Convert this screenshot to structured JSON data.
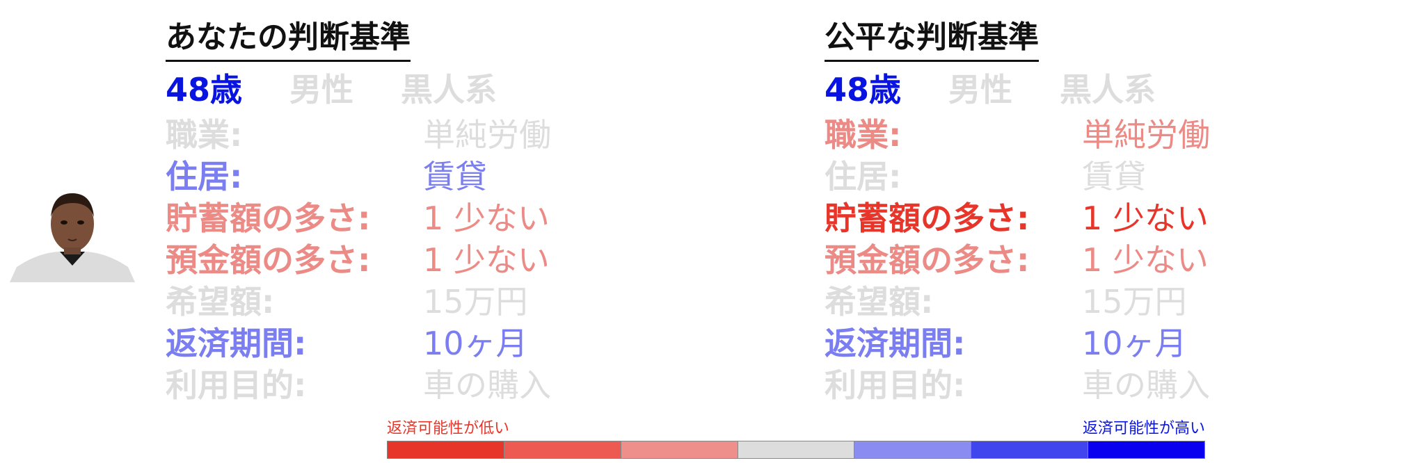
{
  "colors": {
    "gray": "#dddddd",
    "strong_blue": "#0a14e0",
    "mid_blue": "#7a7ef0",
    "strong_red": "#e8352a",
    "mid_red": "#ec8a86",
    "title": "#111111"
  },
  "left_panel": {
    "title": "あなたの判断基準",
    "age": "48歳",
    "gender": "男性",
    "ethnicity": "黒人系",
    "rows": [
      {
        "label": "職業:",
        "value": "単純労働"
      },
      {
        "label": "住居:",
        "value": "賃貸"
      },
      {
        "label": "貯蓄額の多さ:",
        "value": "1 少ない"
      },
      {
        "label": "預金額の多さ:",
        "value": "1 少ない"
      },
      {
        "label": "希望額:",
        "value": "15万円"
      },
      {
        "label": "返済期間:",
        "value": "10ヶ月"
      },
      {
        "label": "利用目的:",
        "value": "車の購入"
      }
    ]
  },
  "right_panel": {
    "title": "公平な判断基準",
    "age": "48歳",
    "gender": "男性",
    "ethnicity": "黒人系",
    "rows": [
      {
        "label": "職業:",
        "value": "単純労働"
      },
      {
        "label": "住居:",
        "value": "賃貸"
      },
      {
        "label": "貯蓄額の多さ:",
        "value": "1 少ない"
      },
      {
        "label": "預金額の多さ:",
        "value": "1 少ない"
      },
      {
        "label": "希望額:",
        "value": "15万円"
      },
      {
        "label": "返済期間:",
        "value": "10ヶ月"
      },
      {
        "label": "利用目的:",
        "value": "車の購入"
      }
    ]
  },
  "legend": {
    "low_label": "返済可能性が低い",
    "high_label": "返済可能性が高い",
    "scale_colors": [
      "#e8352a",
      "#ec5a52",
      "#ef8f8b",
      "#dddddd",
      "#8a8cf2",
      "#4045ee",
      "#0a00f0"
    ]
  }
}
